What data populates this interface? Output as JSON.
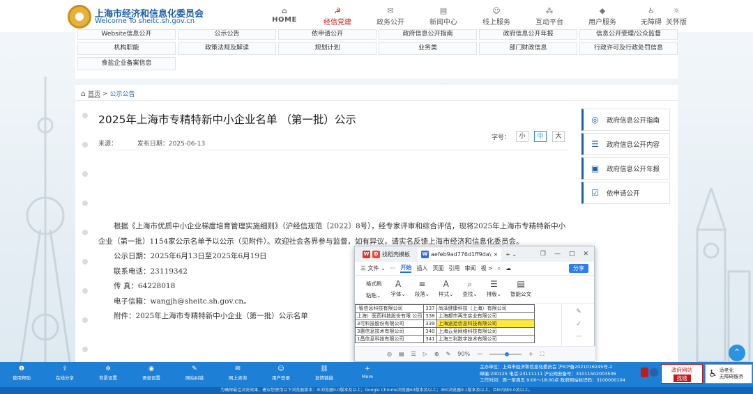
{
  "header": {
    "org_cn": "上海市经济和信息化委员会",
    "org_en": "Welcome To sheitc.sh.gov.cn",
    "nav": [
      {
        "label": "HOME",
        "icon": "home-icon",
        "glyph": "⌂"
      },
      {
        "label": "经信党建",
        "icon": "party-emblem-icon",
        "glyph": "☭"
      },
      {
        "label": "政务公开",
        "icon": "chat-icon",
        "glyph": "✉"
      },
      {
        "label": "新闻中心",
        "icon": "news-icon",
        "glyph": "▤"
      },
      {
        "label": "线上服务",
        "icon": "user-service-icon",
        "glyph": "☺"
      },
      {
        "label": "互动平台",
        "icon": "interaction-icon",
        "glyph": "⁂"
      },
      {
        "label": "用户服务",
        "icon": "diamond-icon",
        "glyph": "◆"
      }
    ],
    "extra": [
      {
        "label": "无障碍",
        "icon": "accessibility-icon",
        "glyph": "♿"
      },
      {
        "label": "关怀版",
        "icon": "care-icon",
        "glyph": "☼"
      }
    ]
  },
  "quicklinks": [
    "Website信息公开",
    "公示公告",
    "依申请公开",
    "政府信息公开指南",
    "政府信息公开年报",
    "信息公开受理/公众监督",
    "机构职能",
    "政策法规及解读",
    "规划计划",
    "业务类",
    "部门财政信息",
    "行政许可及行政处罚信息",
    "食盐企业备案信息"
  ],
  "breadcrumb": {
    "home": "首页",
    "sep": ">",
    "current": "公示公告"
  },
  "article": {
    "title": "2025年上海市专精特新中小企业名单 （第一批）公示",
    "source_label": "来源：",
    "date_label": "发布日期：2025-06-13",
    "font_size_label": "字号：",
    "sizes": [
      "小",
      "中",
      "大"
    ],
    "paragraphs": [
      "根据《上海市优质中小企业梯度培育管理实施细则》（沪经信规范〔2022〕8号），经专家评审和综合评估，现将2025年上海市专精特新中小企业（第一批）1154家公示名单予以公示（见附件）。欢迎社会各界参与监督，如有异议，请实名反馈上海市经济和信息化委员会。",
      "公示日期：2025年6月13日至2025年6月19日",
      "联系电话：23119342",
      "传 真：64228018",
      "电子信箱：wangjh@sheitc.sh.gov.cn。",
      "附件：2025年上海市专精特新中小企业（第一批）公示名单"
    ]
  },
  "sidebar": [
    {
      "label": "政府信息公开指南",
      "icon": "compass-icon",
      "glyph": "◎"
    },
    {
      "label": "政府信息公开内容",
      "icon": "list-icon",
      "glyph": "☰"
    },
    {
      "label": "政府信息公开年报",
      "icon": "folder-icon",
      "glyph": "▣"
    },
    {
      "label": "依申请公开",
      "icon": "checklist-icon",
      "glyph": "☑"
    }
  ],
  "wps": {
    "tab1": "找稻壳模板",
    "tab2": "aefeb9ad776d1ff9da\\",
    "menu": [
      "三 文件 ⌄",
      "···",
      "开始",
      "插入",
      "页面",
      "引用",
      "审阅",
      "视 >"
    ],
    "share": "分享",
    "ribbon": [
      {
        "label": "格式刷",
        "glyph": "🖌"
      },
      {
        "label": "字体⌄",
        "glyph": "A"
      },
      {
        "label": "段落⌄",
        "glyph": "≡"
      },
      {
        "label": "样式⌄",
        "glyph": "A"
      },
      {
        "label": "查找⌄",
        "glyph": "⌕"
      },
      {
        "label": "排版⌄",
        "glyph": "☰"
      },
      {
        "label": "智能公文",
        "glyph": "▤"
      }
    ],
    "paste_label": "粘贴⌄",
    "rows": [
      [
        "-智信息科技有限公司",
        "337",
        "尚泽健康科技（上海）有限公司"
      ],
      [
        "上海）医药科技股份有限\n公司",
        "338",
        "上海都市再生实业有限公司"
      ],
      [
        "3可科技股份有限公司",
        "339",
        "上海途拾信息科技有限公司"
      ],
      [
        "3惠信息技术有限公司",
        "340",
        "上海云竞网络科技有限公司"
      ],
      [
        "1昌信息科技有限公司",
        "341",
        "上海三利数字技术有限公司"
      ]
    ],
    "zoom": "90%"
  },
  "footer": {
    "items": [
      {
        "label": "使用帮助",
        "glyph": "❶"
      },
      {
        "label": "在线分享",
        "glyph": "⇪"
      },
      {
        "label": "背景设置",
        "glyph": "✲"
      },
      {
        "label": "语音设置",
        "glyph": "◉"
      },
      {
        "label": "网站纠错",
        "glyph": "✎"
      },
      {
        "label": "网上咨询",
        "glyph": "✉"
      },
      {
        "label": "用户登录",
        "glyph": "☺"
      },
      {
        "label": "友情链接",
        "glyph": "⛓"
      },
      {
        "label": "More",
        "glyph": "+"
      }
    ],
    "info": [
      "主办单位：上海市经济和信息化委员会  沪ICP备2021016245号-2",
      "邮编:200125 电话:23111111       沪公网安备号：31011502003506",
      "工作时间：周一至周五 9:00～18:00点  政府网站标识码：3100000104"
    ],
    "gov_label_1": "政府网站",
    "gov_label_2": "找错",
    "acc_label_1": "适老化",
    "acc_label_2": "无障碍服务",
    "bottom": "为确保最佳浏览效果，建议您使用以下浏览器版本：IE浏览器9.0版本及以上；Google Chrome浏览器63版本及以上；360浏览器9.1版本及以上，且IE内核9.0及以上。"
  }
}
